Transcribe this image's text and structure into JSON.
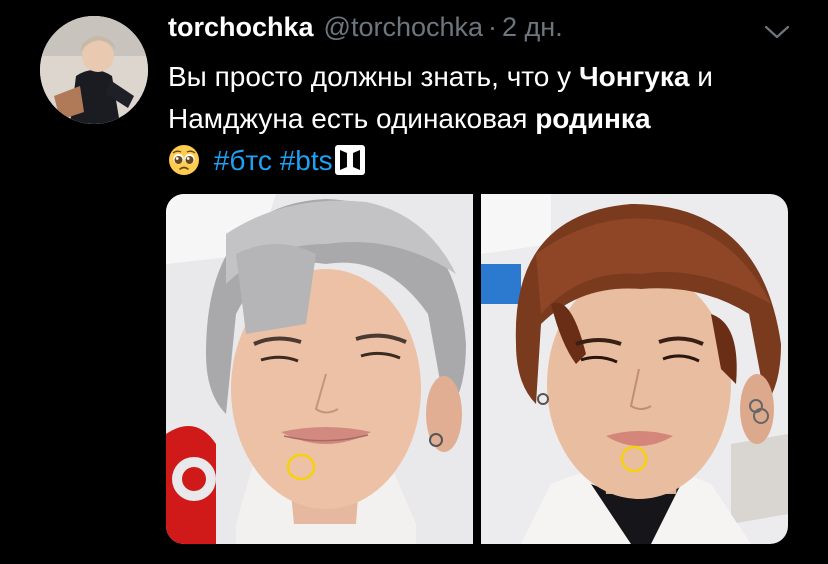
{
  "tweet": {
    "display_name": "torchochka",
    "handle": "@torchochka",
    "separator": "·",
    "timestamp": "2 дн.",
    "text": {
      "part1": "Вы просто должны знать, что у ",
      "bold1": "Чонгука",
      "part2": " и Намджуна есть одинаковая ",
      "bold2": "родинка",
      "hashtag1": "#бтс",
      "hashtag2": "#bts"
    },
    "icons": {
      "menu": "chevron-down-icon",
      "emoji": "pleading-face-emoji",
      "hashtag_emoji": "bts-logo-icon"
    }
  },
  "colors": {
    "background": "#000000",
    "text": "#ffffff",
    "secondary_text": "#6e767d",
    "link": "#1da1f2",
    "annotation_circle": "#f5d20a"
  }
}
